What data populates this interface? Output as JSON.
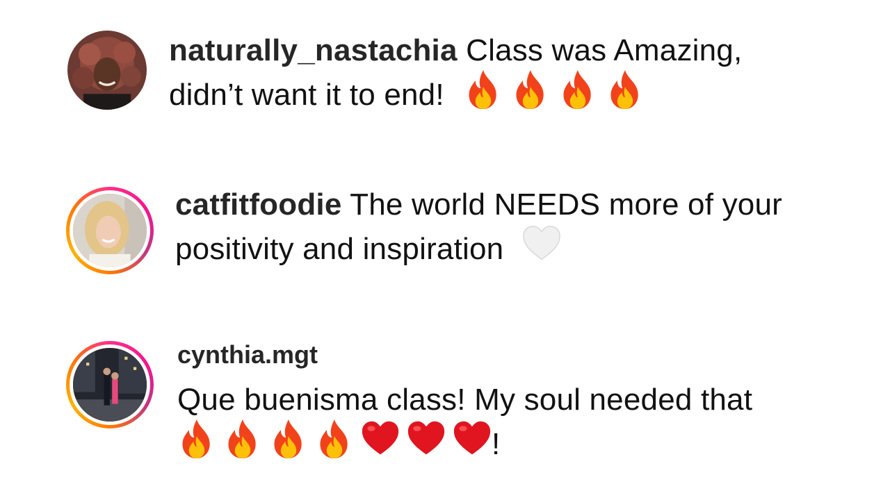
{
  "comments": [
    {
      "username": "naturally_nastachia",
      "text_line1": "Class was Amazing,",
      "text_line2": "didn’t want it to end!",
      "emojis": [
        "fire-icon",
        "fire-icon",
        "fire-icon",
        "fire-icon"
      ],
      "avatar_ring": false
    },
    {
      "username": "catfitfoodie",
      "text_line1": "The world NEEDS more of your",
      "text_line2": "positivity and inspiration",
      "emojis": [
        "white-heart-icon"
      ],
      "avatar_ring": true
    },
    {
      "username": "cynthia.mgt",
      "text_line1": "Que buenisma class! My soul needed that",
      "emojis": [
        "fire-icon",
        "fire-icon",
        "fire-icon",
        "fire-icon",
        "red-heart-icon",
        "red-heart-icon",
        "red-heart-icon"
      ],
      "text_suffix": "!",
      "avatar_ring": true
    }
  ],
  "colors": {
    "ring_pink": "#ff2d8a",
    "ring_orange": "#ff7a00",
    "fire_red": "#f2421b",
    "fire_yellow": "#ffc107",
    "heart_red": "#e0151f",
    "heart_white": "#f0f0f0"
  }
}
